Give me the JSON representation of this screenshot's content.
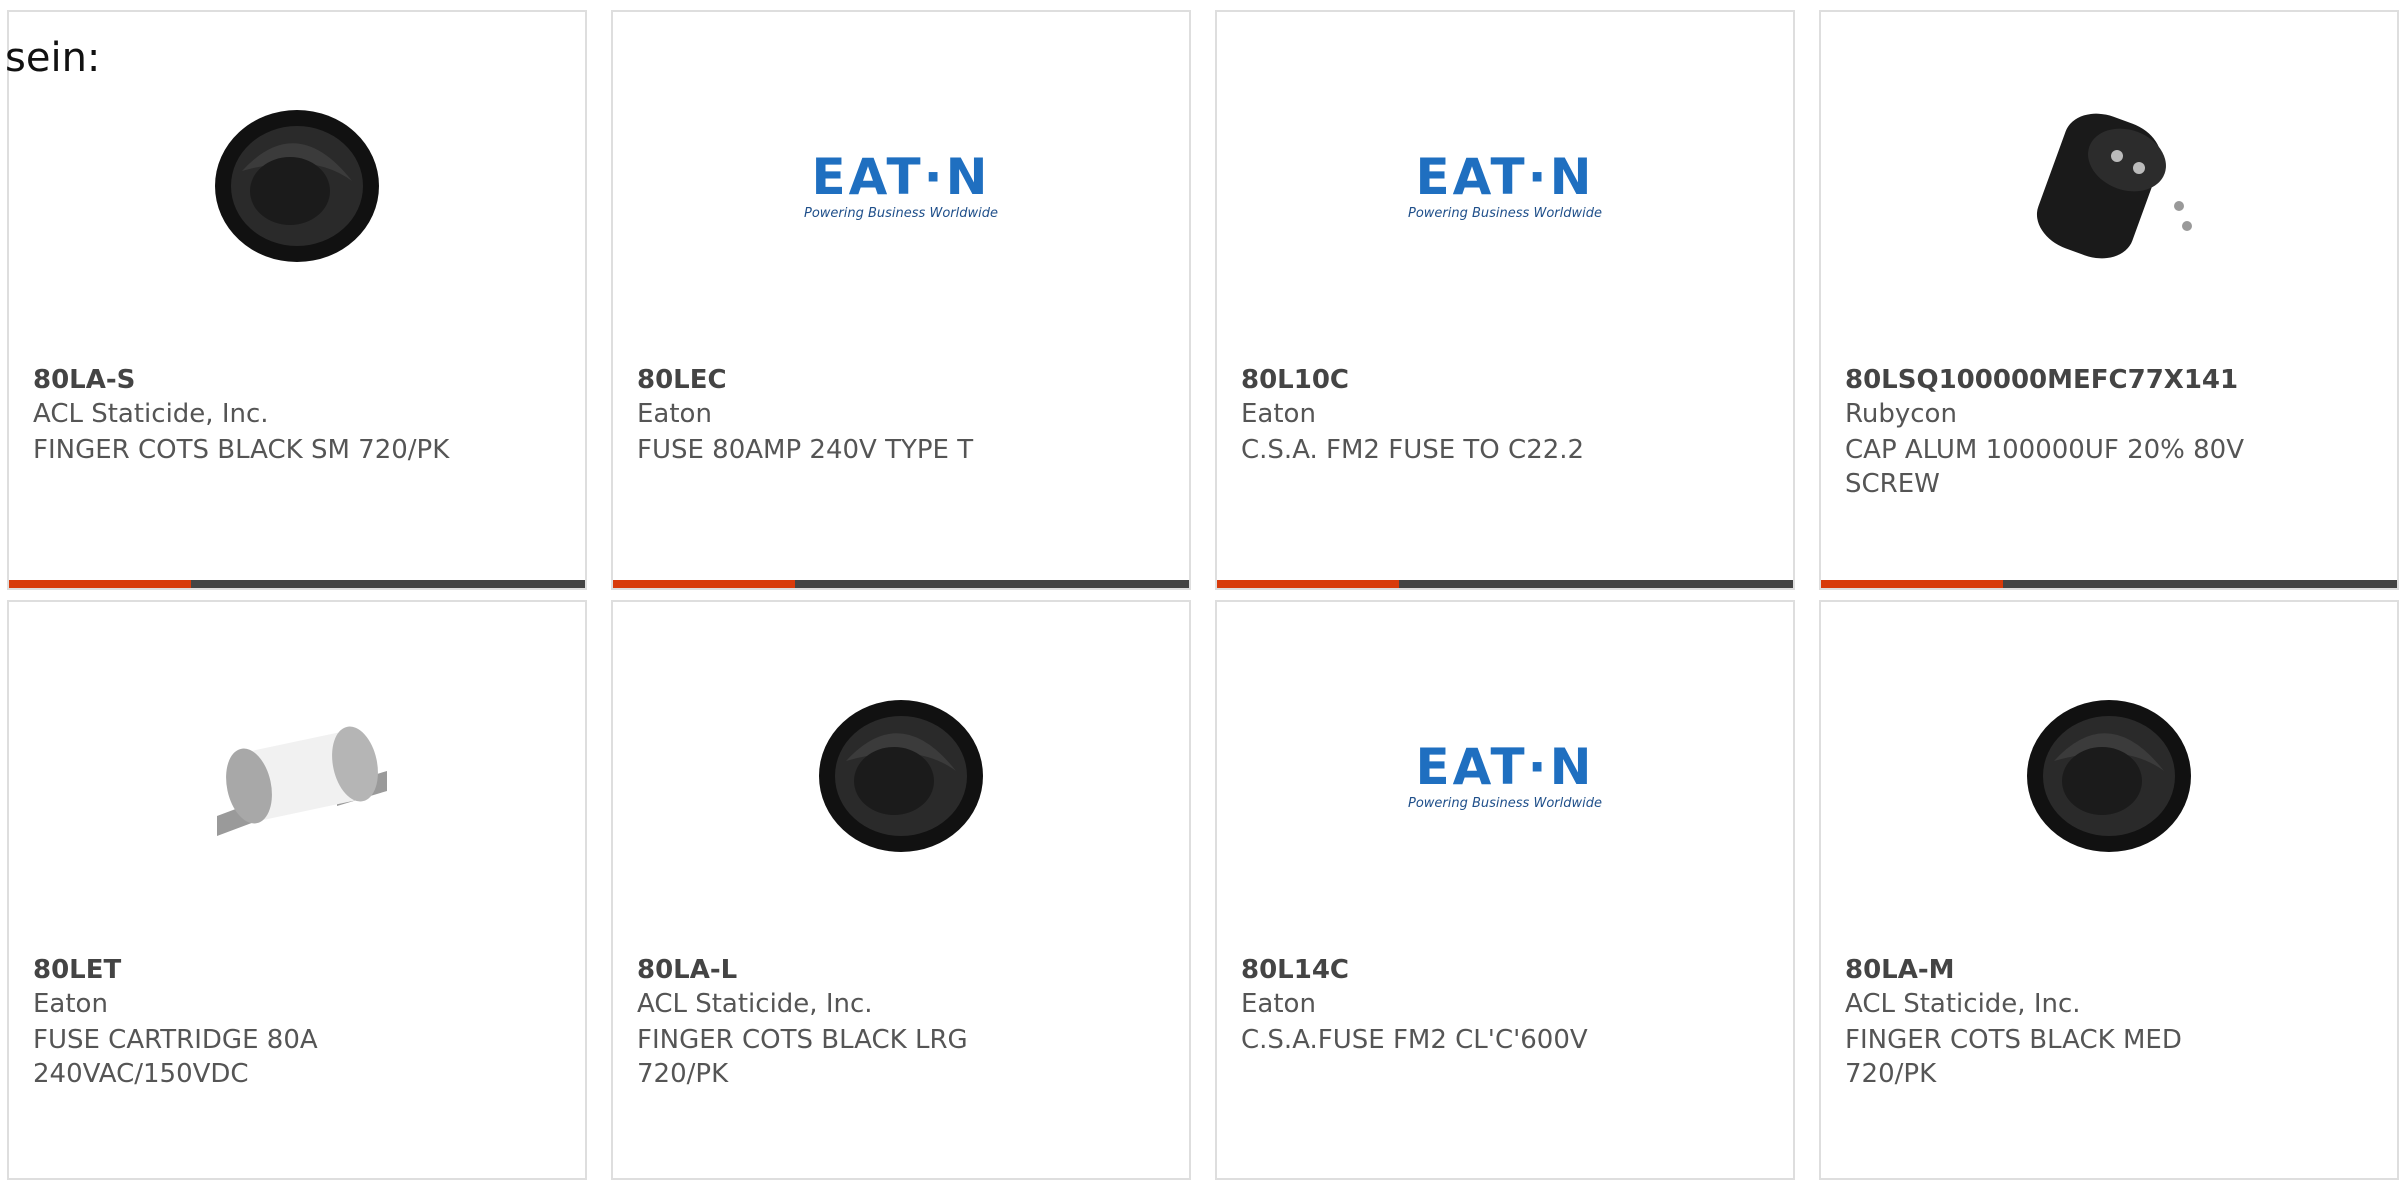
{
  "heading": "sein:",
  "colors": {
    "accent": "#d83b0b",
    "bar": "#444444",
    "brand_eaton": "#1f6fc0"
  },
  "products": [
    {
      "part": "80LA-S",
      "maker": "ACL Staticide, Inc.",
      "desc": "FINGER COTS BLACK SM 720/PK",
      "image": "finger-cot-icon"
    },
    {
      "part": "80LEC",
      "maker": "Eaton",
      "desc": "FUSE 80AMP 240V TYPE T",
      "image": "eaton-logo",
      "logo_word": "EAT·N",
      "logo_tag": "Powering Business Worldwide"
    },
    {
      "part": "80L10C",
      "maker": "Eaton",
      "desc": "C.S.A. FM2 FUSE TO C22.2",
      "image": "eaton-logo",
      "logo_word": "EAT·N",
      "logo_tag": "Powering Business Worldwide"
    },
    {
      "part": "80LSQ100000MEFC77X141",
      "maker": "Rubycon",
      "desc": "CAP ALUM 100000UF 20% 80V SCREW",
      "image": "capacitor-icon"
    },
    {
      "part": "80LET",
      "maker": "Eaton",
      "desc": "FUSE CARTRIDGE 80A 240VAC/150VDC",
      "image": "fuse-cartridge-icon"
    },
    {
      "part": "80LA-L",
      "maker": "ACL Staticide, Inc.",
      "desc": "FINGER COTS BLACK LRG 720/PK",
      "image": "finger-cot-icon"
    },
    {
      "part": "80L14C",
      "maker": "Eaton",
      "desc": "C.S.A.FUSE FM2 CL'C'600V",
      "image": "eaton-logo",
      "logo_word": "EAT·N",
      "logo_tag": "Powering Business Worldwide"
    },
    {
      "part": "80LA-M",
      "maker": "ACL Staticide, Inc.",
      "desc": "FINGER COTS BLACK MED 720/PK",
      "image": "finger-cot-icon"
    }
  ]
}
